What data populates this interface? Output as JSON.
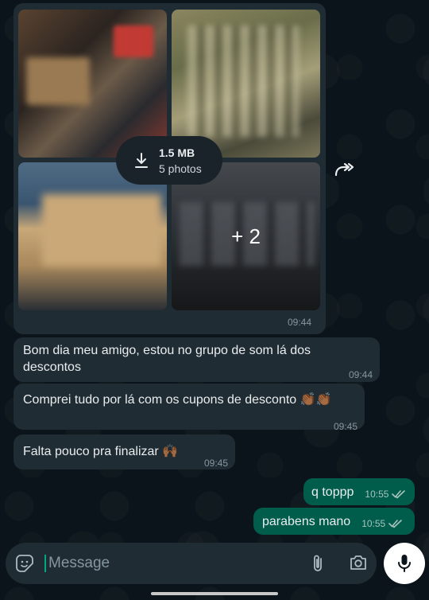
{
  "album": {
    "download_size": "1.5 MB",
    "download_count": "5 photos",
    "more_count": "+ 2",
    "time": "09:44"
  },
  "messages": [
    {
      "text": "Bom dia meu amigo, estou no grupo de som lá dos descontos",
      "time": "09:44"
    },
    {
      "text": "Comprei tudo por lá com os cupons de desconto",
      "emoji": "👏🏾👏🏾",
      "time": "09:45"
    },
    {
      "text": "Falta pouco pra finalizar",
      "emoji": "🙌🏾",
      "time": "09:45"
    }
  ],
  "sent": [
    {
      "text": "q toppp",
      "time": "10:55"
    },
    {
      "text": "parabens mano",
      "time": "10:55"
    }
  ],
  "composer": {
    "placeholder": "Message"
  },
  "colors": {
    "incoming_bubble": "#202c33",
    "outgoing_bubble": "#005c4b",
    "background": "#0b141a",
    "read_tick": "#a7c4bd"
  }
}
